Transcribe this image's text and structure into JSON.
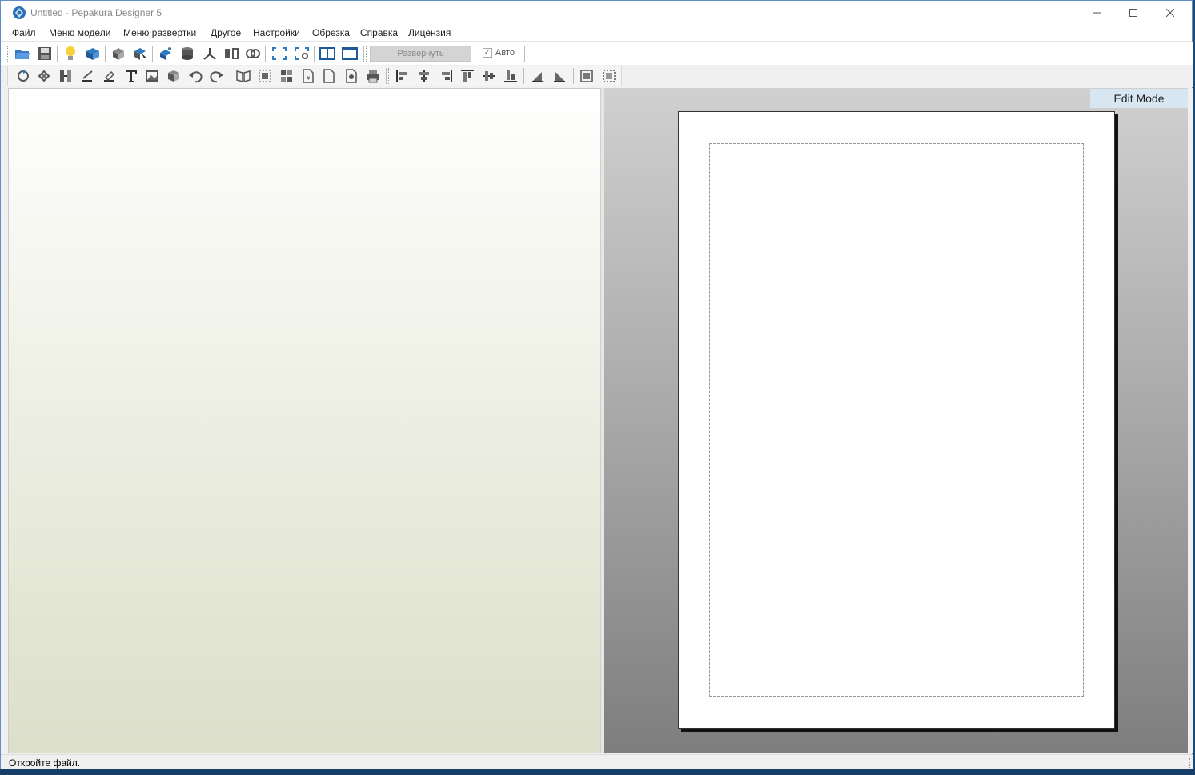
{
  "window": {
    "title": "Untitled - Pepakura Designer 5",
    "controls": {
      "minimize": "—",
      "maximize": "☐",
      "close": "✕"
    }
  },
  "menu": [
    "Файл",
    "Меню модели",
    "Меню развертки",
    "Другое",
    "Настройки",
    "Обрезка",
    "Справка",
    "Лицензия"
  ],
  "toolbar": {
    "unfold_label": "Развернуть",
    "auto_label": "Авто",
    "auto_checked": true,
    "top_icons": [
      "open-icon",
      "save-icon",
      "lightbulb-icon",
      "unfold-model-icon",
      "rotate-model-icon",
      "select-model-icon",
      "paint-icon",
      "cylinder-icon",
      "axes-icon",
      "split-icon",
      "link-icon",
      "fit-view-icon",
      "fit-settings-icon",
      "two-pane-icon",
      "single-pane-icon"
    ],
    "bottom_icons": [
      "rotate-icon",
      "rotate-part-icon",
      "join-icon",
      "line-icon",
      "erase-line-icon",
      "text-icon",
      "image-icon",
      "box-icon",
      "undo-icon",
      "redo-icon",
      "book-icon",
      "arrange-icon",
      "grid-icon",
      "page-number-icon",
      "page-icon",
      "photo-icon",
      "print-icon",
      "align-left-icon",
      "align-center-icon",
      "align-right-icon",
      "align-top-icon",
      "align-middle-icon",
      "align-bottom-icon",
      "flip-left-icon",
      "flip-right-icon",
      "group-icon",
      "ungroup-icon"
    ]
  },
  "right_pane": {
    "mode_label": "Edit Mode"
  },
  "status": {
    "text": "Откройте файл."
  }
}
